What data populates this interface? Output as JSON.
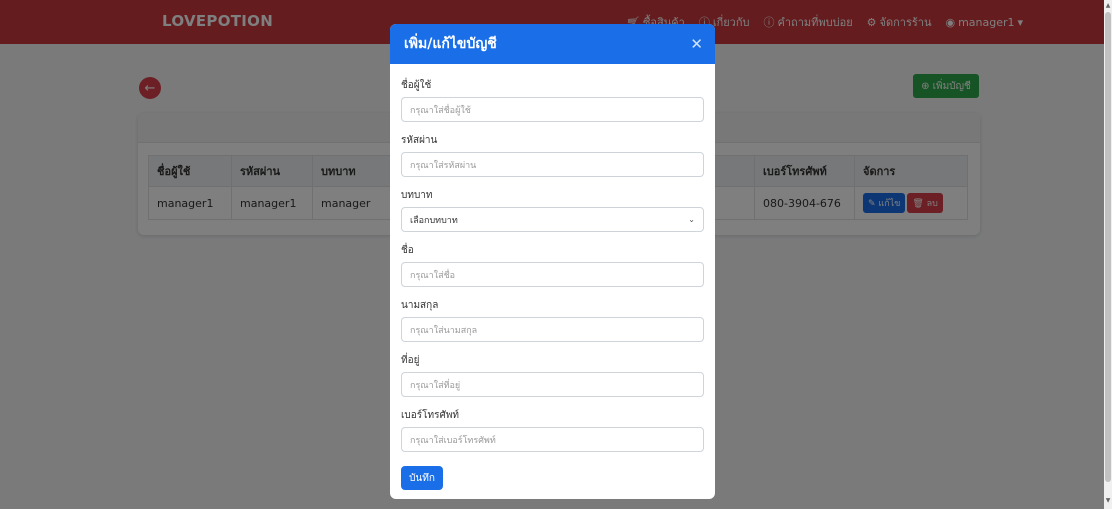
{
  "navbar": {
    "brand": "LOVEPOTION",
    "items": [
      {
        "icon": "cart-icon",
        "label": "ซื้อสินค้า"
      },
      {
        "icon": "info-icon",
        "label": "เกี่ยวกับ"
      },
      {
        "icon": "question-icon",
        "label": "คำถามที่พบบ่อย"
      },
      {
        "icon": "gear-icon",
        "label": "จัดการร้าน"
      },
      {
        "icon": "user-icon",
        "label": "manager1"
      }
    ],
    "dropdown_caret": "▾"
  },
  "page": {
    "back_symbol": "←",
    "add_account_label": "เพิ่มบัญชี",
    "add_account_icon": "⊕",
    "table": {
      "headers": [
        "ชื่อผู้ใช้",
        "รหัสผ่าน",
        "บทบาท",
        "",
        "",
        "",
        "เบอร์โทรศัพท์",
        "จัดการ"
      ],
      "rows": [
        {
          "username": "manager1",
          "password": "manager1",
          "role": "manager",
          "phone": "080-3904-676",
          "edit": "แก้ไข",
          "delete": "ลบ"
        }
      ]
    }
  },
  "modal": {
    "title": "เพิ่ม/แก้ไขบัญชี",
    "close_symbol": "✕",
    "fields": {
      "username": {
        "label": "ชื่อผู้ใช้",
        "placeholder": "กรุณาใส่ชื่อผู้ใช้"
      },
      "password": {
        "label": "รหัสผ่าน",
        "placeholder": "กรุณาใส่รหัสผ่าน"
      },
      "role": {
        "label": "บทบาท",
        "value": "เลือกบทบาท"
      },
      "firstname": {
        "label": "ชื่อ",
        "placeholder": "กรุณาใส่ชื่อ"
      },
      "lastname": {
        "label": "นามสกุล",
        "placeholder": "กรุณาใส่นามสกุล"
      },
      "address": {
        "label": "ที่อยู่",
        "placeholder": "กรุณาใส่ที่อยู่"
      },
      "phone": {
        "label": "เบอร์โทรศัพท์",
        "placeholder": "กรุณาใส่เบอร์โทรศัพท์"
      }
    },
    "save_label": "บันทึก"
  },
  "colors": {
    "navbar": "#c9383e",
    "modal_header": "#1a6fe8",
    "add_button": "#2ea84a",
    "delete_button": "#d9404a"
  }
}
